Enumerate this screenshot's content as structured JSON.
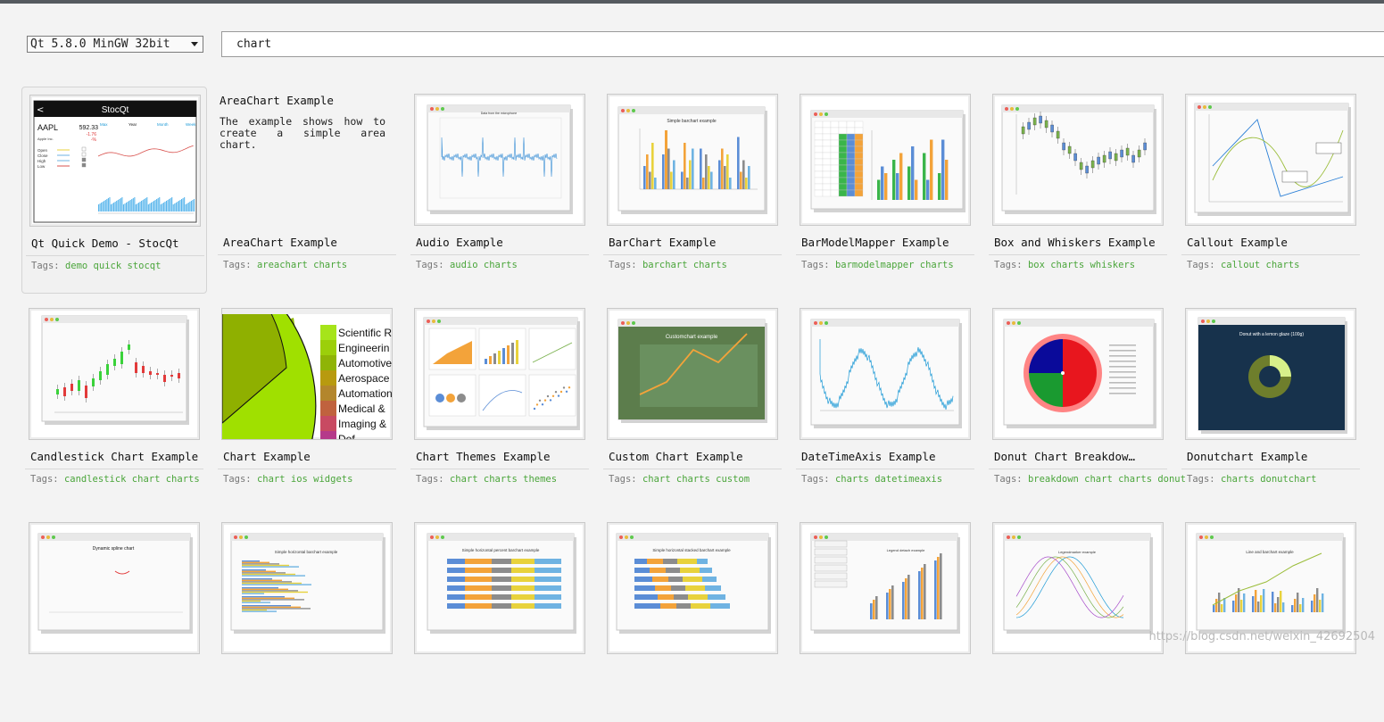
{
  "kit_selector": {
    "value": "Qt 5.8.0 MinGW 32bit"
  },
  "search": {
    "value": "chart"
  },
  "tags_prefix": "Tags:",
  "examples": [
    {
      "title": "Qt Quick Demo - StocQt",
      "tags": "demo quick stocqt",
      "selected": true,
      "thumb": {
        "app_title": "StocQt",
        "symbol": "AAPL",
        "price": "592.33",
        "change": "-1.76",
        "pct": "-%",
        "company": "Apple Inc.",
        "tabs": [
          "Max",
          "Year",
          "Month",
          "Week"
        ],
        "legend": [
          "Open",
          "Close",
          "High",
          "Low"
        ]
      }
    },
    {
      "title": "AreaChart Example",
      "tags": "areachart charts",
      "description": "The example shows how to create a simple area chart."
    },
    {
      "title": "Audio Example",
      "tags": "audio charts"
    },
    {
      "title": "BarChart Example",
      "tags": "barchart charts",
      "thumb": {
        "caption": "Simple barchart example"
      }
    },
    {
      "title": "BarModelMapper Example",
      "tags": "barmodelmapper charts"
    },
    {
      "title": "Box and Whiskers Example",
      "tags": "box charts whiskers"
    },
    {
      "title": "Callout Example",
      "tags": "callout charts"
    },
    {
      "title": "Candlestick Chart Example",
      "tags": "candlestick chart charts"
    },
    {
      "title": "Chart Example",
      "tags": "chart ios widgets",
      "thumb": {
        "legend": [
          "Scientific R",
          "Engineerin",
          "Automotive",
          "Aerospace",
          "Automation",
          "Medical &",
          "Imaging &",
          "Def"
        ]
      }
    },
    {
      "title": "Chart Themes Example",
      "tags": "chart charts themes"
    },
    {
      "title": "Custom Chart Example",
      "tags": "chart charts custom",
      "thumb": {
        "caption": "Customchart example"
      }
    },
    {
      "title": "DateTimeAxis Example",
      "tags": "charts datetimeaxis"
    },
    {
      "title": "Donut Chart Breakdow…",
      "tags": "breakdown chart charts donut"
    },
    {
      "title": "Donutchart Example",
      "tags": "charts donutchart",
      "thumb": {
        "caption": "Donut with a lemon glaze (100g)"
      }
    },
    {
      "title": "",
      "tags": "",
      "thumb": {
        "caption": "Dynamic spline chart"
      }
    },
    {
      "title": "",
      "tags": "",
      "thumb": {
        "caption": "Simple horizontal barchart example"
      }
    },
    {
      "title": "",
      "tags": "",
      "thumb": {
        "caption": "Simple horizontal percent barchart example"
      }
    },
    {
      "title": "",
      "tags": "",
      "thumb": {
        "caption": "Simple horizontal stacked barchart example"
      }
    },
    {
      "title": "",
      "tags": "",
      "thumb": {
        "caption": "Legend detach example"
      }
    },
    {
      "title": "",
      "tags": "",
      "thumb": {
        "caption": "Legendmarker example"
      }
    },
    {
      "title": "",
      "tags": "",
      "thumb": {
        "caption": "Line and barchart example"
      }
    }
  ],
  "watermark": "https://blog.csdn.net/weixin_42692504",
  "colors": {
    "tag_green": "#4aa53a",
    "title_text": "#111111",
    "tag_label": "#777777"
  }
}
